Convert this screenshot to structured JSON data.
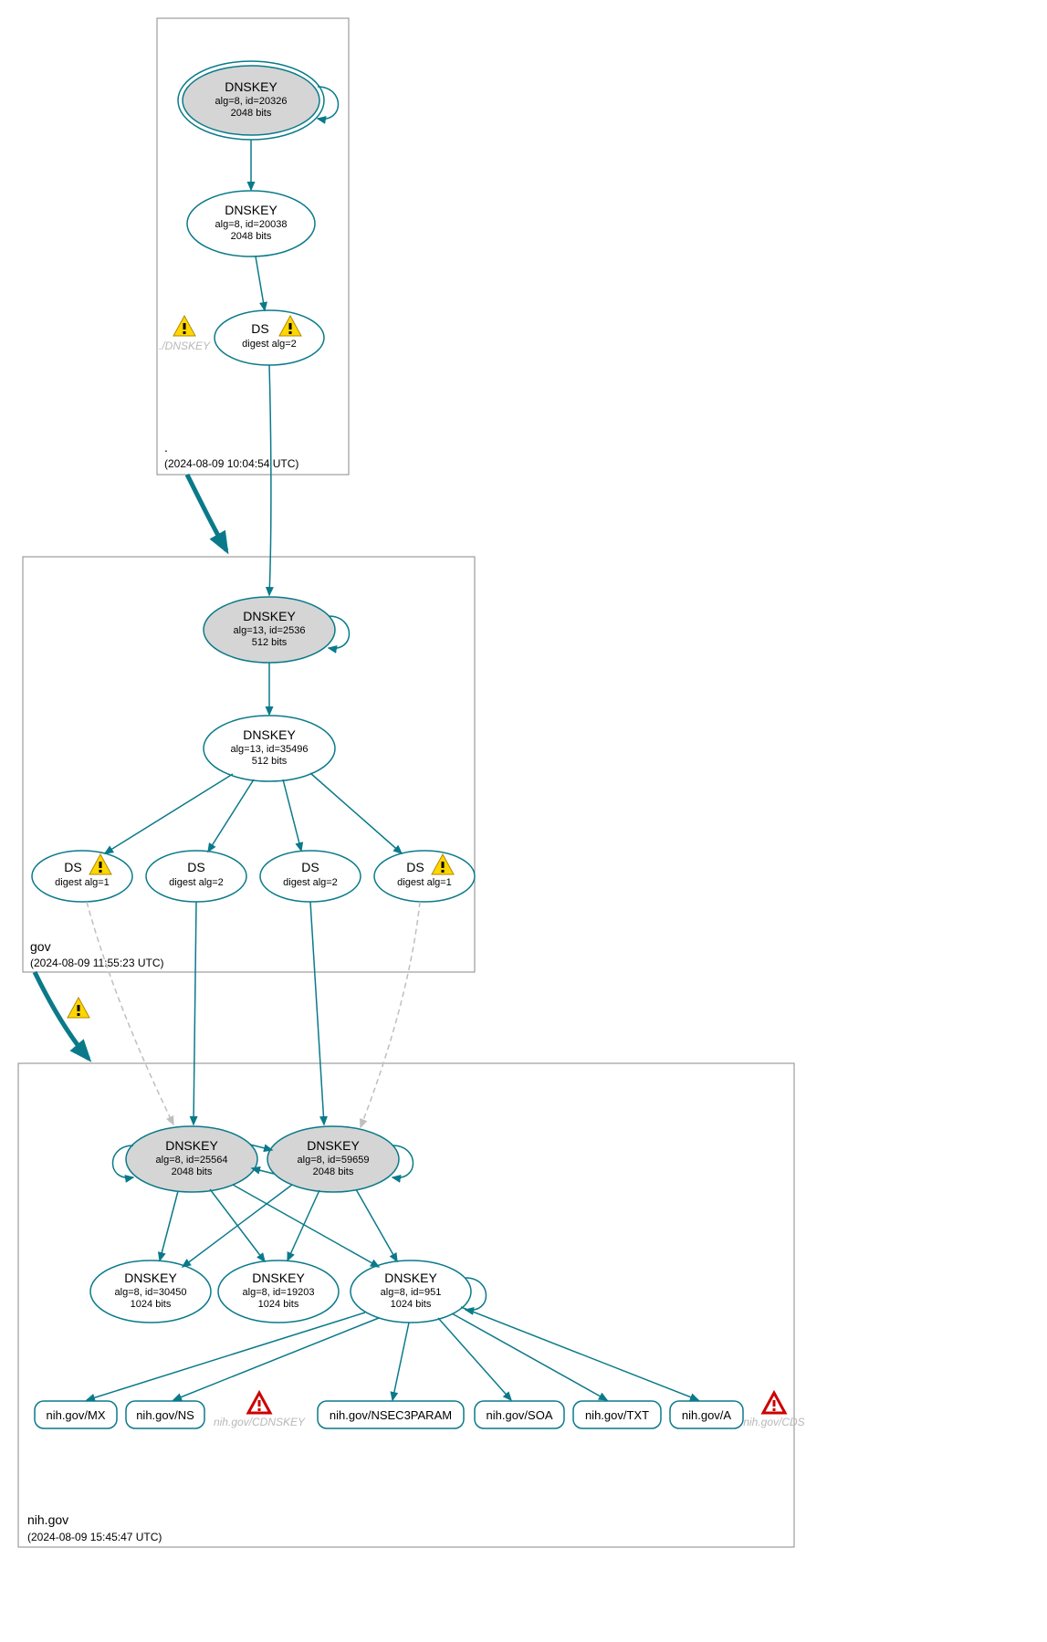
{
  "colors": {
    "stroke": "#0a7a8a",
    "sep_fill": "#d5d5d5",
    "grey": "#bfbfbf",
    "warn_yellow": "#ffd600",
    "warn_red": "#cc0000"
  },
  "zones": {
    "root": {
      "name": ".",
      "timestamp": "(2024-08-09 10:04:54 UTC)",
      "nodes": {
        "ksk": {
          "title": "DNSKEY",
          "detail": "alg=8, id=20326",
          "bits": "2048 bits"
        },
        "zsk": {
          "title": "DNSKEY",
          "detail": "alg=8, id=20038",
          "bits": "2048 bits"
        },
        "ds": {
          "title": "DS",
          "detail": "digest alg=2"
        },
        "ghost_dnskey": "./DNSKEY"
      }
    },
    "gov": {
      "name": "gov",
      "timestamp": "(2024-08-09 11:55:23 UTC)",
      "nodes": {
        "ksk": {
          "title": "DNSKEY",
          "detail": "alg=13, id=2536",
          "bits": "512 bits"
        },
        "zsk": {
          "title": "DNSKEY",
          "detail": "alg=13, id=35496",
          "bits": "512 bits"
        },
        "ds1": {
          "title": "DS",
          "detail": "digest alg=1"
        },
        "ds2": {
          "title": "DS",
          "detail": "digest alg=2"
        },
        "ds3": {
          "title": "DS",
          "detail": "digest alg=2"
        },
        "ds4": {
          "title": "DS",
          "detail": "digest alg=1"
        }
      }
    },
    "nih": {
      "name": "nih.gov",
      "timestamp": "(2024-08-09 15:45:47 UTC)",
      "nodes": {
        "ksk1": {
          "title": "DNSKEY",
          "detail": "alg=8, id=25564",
          "bits": "2048 bits"
        },
        "ksk2": {
          "title": "DNSKEY",
          "detail": "alg=8, id=59659",
          "bits": "2048 bits"
        },
        "zsk1": {
          "title": "DNSKEY",
          "detail": "alg=8, id=30450",
          "bits": "1024 bits"
        },
        "zsk2": {
          "title": "DNSKEY",
          "detail": "alg=8, id=19203",
          "bits": "1024 bits"
        },
        "zsk3": {
          "title": "DNSKEY",
          "detail": "alg=8, id=951",
          "bits": "1024 bits"
        },
        "rr_mx": "nih.gov/MX",
        "rr_ns": "nih.gov/NS",
        "rr_nsec": "nih.gov/NSEC3PARAM",
        "rr_soa": "nih.gov/SOA",
        "rr_txt": "nih.gov/TXT",
        "rr_a": "nih.gov/A",
        "ghost_cdnskey": "nih.gov/CDNSKEY",
        "ghost_cds": "nih.gov/CDS"
      }
    }
  }
}
